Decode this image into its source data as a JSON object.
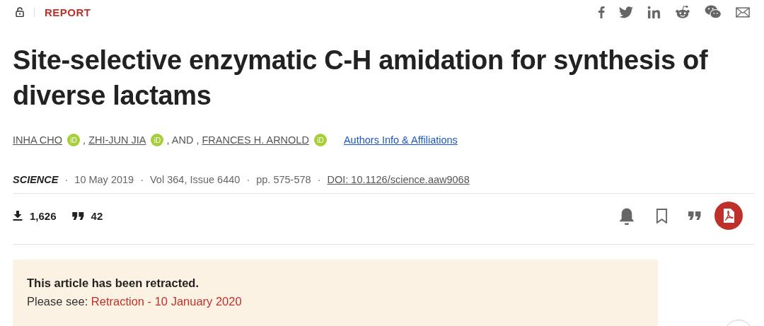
{
  "header": {
    "article_type": "REPORT"
  },
  "title": "Site-selective enzymatic C-H amidation for synthesis of diverse lactams",
  "authors": [
    {
      "name": "INHA CHO",
      "badge": "iD",
      "joiner": ","
    },
    {
      "name": "ZHI-JUN JIA",
      "badge": "iD",
      "joiner": ", AND ,"
    },
    {
      "name": "FRANCES H. ARNOLD",
      "badge": "iD"
    }
  ],
  "authors_link": "Authors Info & Affiliations",
  "meta": {
    "separator": "·",
    "items": [
      {
        "kind": "journal",
        "text": "SCIENCE"
      },
      {
        "kind": "plain",
        "text": "10 May 2019"
      },
      {
        "kind": "plain",
        "text": "Vol 364, Issue 6440"
      },
      {
        "kind": "plain",
        "text": "pp. 575-578"
      },
      {
        "kind": "link",
        "text": "DOI: 10.1126/science.aaw9068"
      }
    ]
  },
  "metrics": {
    "downloads": "1,626",
    "citations": "42"
  },
  "retraction": {
    "heading": "This article has been retracted.",
    "prefix": "Please see:",
    "link": "Retraction - 10 January 2020"
  }
}
